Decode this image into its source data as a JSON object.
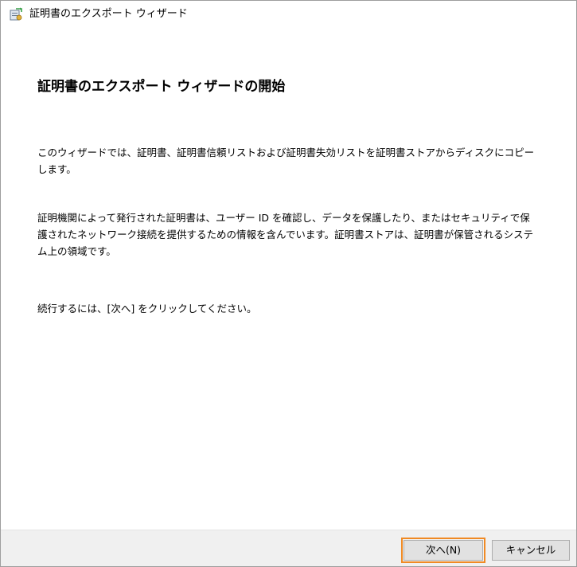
{
  "window": {
    "title": "証明書のエクスポート ウィザード",
    "icon": "certificate-wizard-icon"
  },
  "content": {
    "heading": "証明書のエクスポート ウィザードの開始",
    "paragraphs": [
      "このウィザードでは、証明書、証明書信頼リストおよび証明書失効リストを証明書ストアからディスクにコピーします。",
      "証明機関によって発行された証明書は、ユーザー ID を確認し、データを保護したり、またはセキュリティで保護されたネットワーク接続を提供するための情報を含んでいます。証明書ストアは、証明書が保管されるシステム上の領域です。",
      "続行するには、[次へ] をクリックしてください。"
    ]
  },
  "buttons": {
    "next_label": "次へ(N)",
    "cancel_label": "キャンセル"
  },
  "colors": {
    "focus_outline": "#f08a24",
    "footer_bg": "#f0f0f0",
    "button_bg": "#e1e1e1"
  }
}
